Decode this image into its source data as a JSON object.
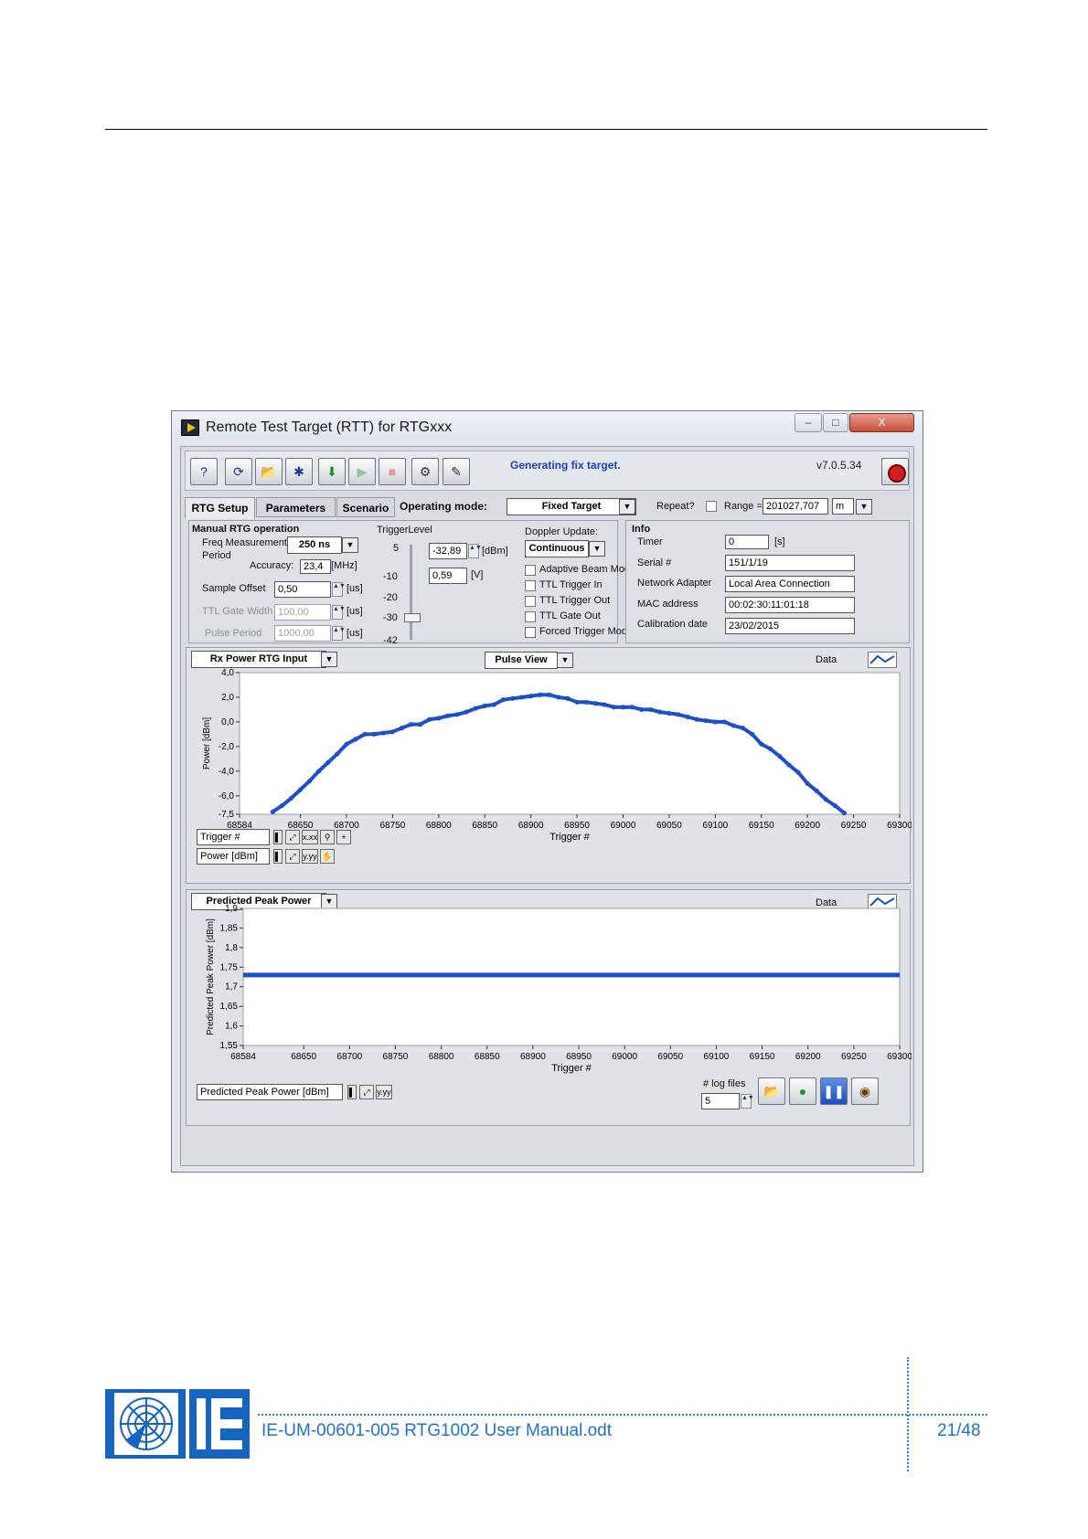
{
  "window": {
    "title": "Remote Test Target (RTT) for RTGxxx",
    "minimize": "–",
    "maximize": "□",
    "close": "X"
  },
  "toolbar": {
    "status": "Generating fix target.",
    "version": "v7.0.5.34",
    "buttons": [
      {
        "name": "help-icon",
        "glyph": "?"
      },
      {
        "name": "refresh-icon",
        "glyph": "⟳"
      },
      {
        "name": "open-folder-icon",
        "glyph": "📂"
      },
      {
        "name": "satellite-icon",
        "glyph": "✱"
      },
      {
        "name": "download-icon",
        "glyph": "⬇"
      },
      {
        "name": "play-icon",
        "glyph": "▶"
      },
      {
        "name": "stop-square-icon",
        "glyph": "■"
      },
      {
        "name": "settings-group-icon",
        "glyph": "⚙"
      },
      {
        "name": "edit-config-icon",
        "glyph": "✎"
      }
    ]
  },
  "tabs": [
    "RTG Setup",
    "Parameters",
    "Scenario"
  ],
  "operating_mode": {
    "label": "Operating mode:",
    "value": "Fixed Target"
  },
  "repeat_label": "Repeat?",
  "range": {
    "label": "Range =",
    "value": "201027,707",
    "unit": "m"
  },
  "manual": {
    "title": "Manual RTG operation",
    "freq_label_1": "Freq Measurement",
    "freq_label_2": "Period",
    "freq_value": "250 ns",
    "accuracy_label": "Accuracy:",
    "accuracy_value": "23,4",
    "accuracy_unit": "[MHz]",
    "sample_offset_label": "Sample Offset",
    "sample_offset_value": "0,50",
    "sample_offset_unit": "[us]",
    "ttl_gate_label": "TTL Gate Width",
    "ttl_gate_value": "100,00",
    "ttl_gate_unit": "[us]",
    "pulse_period_label": "Pulse Period",
    "pulse_period_value": "1000,00",
    "pulse_period_unit": "[us]"
  },
  "trigger": {
    "label": "TriggerLevel",
    "scale": [
      "5",
      "-10",
      "-20",
      "-30",
      "-42"
    ],
    "dbm_value": "-32,89",
    "dbm_unit": "[dBm]",
    "v_value": "0,59",
    "v_unit": "[V]"
  },
  "doppler": {
    "label": "Doppler Update:",
    "value": "Continuous",
    "options": [
      "Adaptive Beam Mod",
      "TTL Trigger In",
      "TTL Trigger Out",
      "TTL Gate Out",
      "Forced Trigger Mode"
    ]
  },
  "info": {
    "title": "Info",
    "timer_label": "Timer",
    "timer_value": "0",
    "timer_unit": "[s]",
    "serial_label": "Serial #",
    "serial_value": "151/1/19",
    "adapter_label": "Network Adapter",
    "adapter_value": "Local Area Connection",
    "mac_label": "MAC address",
    "mac_value": "00:02:30:11:01:18",
    "calib_label": "Calibration date",
    "calib_value": "23/02/2015"
  },
  "graph1": {
    "selector": "Rx Power RTG Input",
    "view": "Pulse  View",
    "data_label": "Data",
    "legend_x": "Trigger #",
    "legend_y": "Power [dBm]"
  },
  "graph2": {
    "selector": "Predicted Peak Power",
    "data_label": "Data",
    "legend_y": "Predicted Peak Power [dBm]",
    "log_files_label": "# log files",
    "log_files_value": "5"
  },
  "chart_data": [
    {
      "type": "scatter",
      "xlabel": "Trigger #",
      "ylabel": "Power [dBm]",
      "xlim": [
        68584,
        69300
      ],
      "ylim": [
        -7.5,
        4.0
      ],
      "x_ticks": [
        "68584",
        "68650",
        "68700",
        "68750",
        "68800",
        "68850",
        "68900",
        "68950",
        "69000",
        "69050",
        "69100",
        "69150",
        "69200",
        "69250",
        "69300"
      ],
      "y_ticks": [
        "4,0",
        "2,0",
        "0,0",
        "-2,0",
        "-4,0",
        "-6,0",
        "-7,5"
      ],
      "series": [
        {
          "color": "#1f4fc4",
          "x": [
            68620,
            68630,
            68640,
            68650,
            68660,
            68670,
            68680,
            68690,
            68700,
            68710,
            68720,
            68730,
            68740,
            68750,
            68760,
            68770,
            68780,
            68790,
            68800,
            68810,
            68820,
            68830,
            68840,
            68850,
            68860,
            68870,
            68880,
            68890,
            68900,
            68910,
            68920,
            68930,
            68940,
            68950,
            68960,
            68970,
            68980,
            68990,
            69000,
            69010,
            69020,
            69030,
            69040,
            69050,
            69060,
            69070,
            69080,
            69090,
            69100,
            69110,
            69120,
            69130,
            69140,
            69150,
            69160,
            69170,
            69180,
            69190,
            69200,
            69210,
            69220,
            69230,
            69240
          ],
          "y": [
            -7.3,
            -6.8,
            -6.2,
            -5.5,
            -4.8,
            -4.0,
            -3.3,
            -2.6,
            -1.8,
            -1.4,
            -1.0,
            -1.0,
            -0.9,
            -0.8,
            -0.5,
            -0.2,
            -0.2,
            0.2,
            0.3,
            0.5,
            0.6,
            0.8,
            1.1,
            1.3,
            1.4,
            1.8,
            1.9,
            2.0,
            2.1,
            2.2,
            2.2,
            2.0,
            1.9,
            1.6,
            1.6,
            1.5,
            1.4,
            1.2,
            1.2,
            1.2,
            1.0,
            1.0,
            0.8,
            0.7,
            0.6,
            0.4,
            0.2,
            0.1,
            0.0,
            0.0,
            -0.3,
            -0.5,
            -1.0,
            -1.8,
            -2.2,
            -2.8,
            -3.5,
            -4.1,
            -5.0,
            -5.6,
            -6.3,
            -6.8,
            -7.4
          ]
        }
      ]
    },
    {
      "type": "line",
      "xlabel": "Trigger #",
      "ylabel": "Predicted Peak Power [dBm]",
      "xlim": [
        68584,
        69300
      ],
      "ylim": [
        1.55,
        1.9
      ],
      "x_ticks": [
        "68584",
        "68650",
        "68700",
        "68750",
        "68800",
        "68850",
        "68900",
        "68950",
        "69000",
        "69050",
        "69100",
        "69150",
        "69200",
        "69250",
        "69300"
      ],
      "y_ticks": [
        "1,9",
        "1,85",
        "1,8",
        "1,75",
        "1,7",
        "1,65",
        "1,6",
        "1,55"
      ],
      "series": [
        {
          "color": "#1f4fc4",
          "x": [
            68584,
            69300
          ],
          "y": [
            1.73,
            1.73
          ]
        }
      ]
    }
  ],
  "footer": {
    "doc": "IE-UM-00601-005 RTG1002 User Manual.odt",
    "page": "21/48"
  }
}
